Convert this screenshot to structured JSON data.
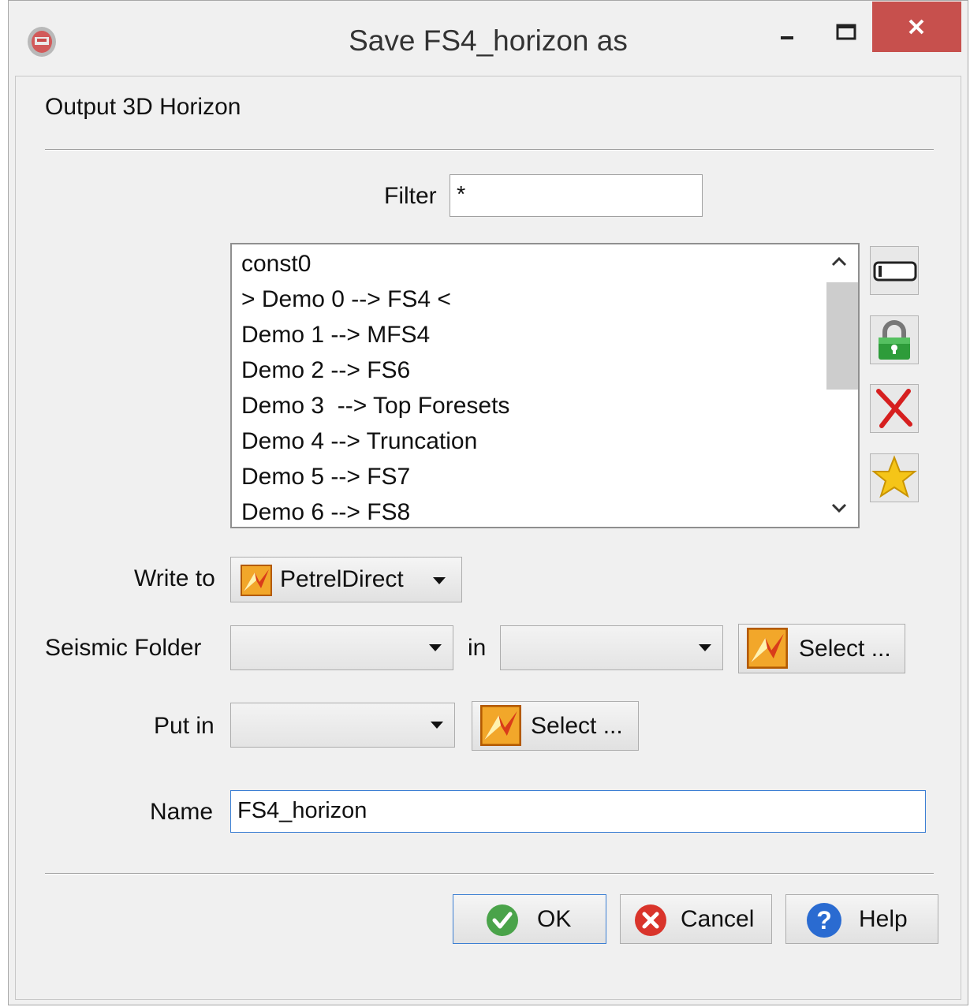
{
  "window": {
    "title": "Save FS4_horizon as"
  },
  "controls": {
    "minimize": "–",
    "maximize": "☐",
    "close": "✕"
  },
  "section": {
    "title": "Output 3D Horizon"
  },
  "filter": {
    "label": "Filter",
    "value": "*"
  },
  "list": {
    "items": [
      "const0",
      "> Demo 0 --> FS4 <",
      "Demo 1 --> MFS4",
      "Demo 2 --> FS6",
      "Demo 3  --> Top Foresets",
      "Demo 4 --> Truncation",
      "Demo 5 --> FS7",
      "Demo 6 --> FS8"
    ],
    "scroll_up": "^",
    "scroll_down": "v"
  },
  "side_buttons": {
    "icons": [
      "rename-icon",
      "lock-icon",
      "delete-icon",
      "favorite-icon"
    ]
  },
  "write_to": {
    "label": "Write to",
    "value": "PetrelDirect"
  },
  "seismic_folder": {
    "label": "Seismic Folder",
    "value": "",
    "in_label": "in",
    "in_value": "",
    "select_label": "Select ..."
  },
  "put_in": {
    "label": "Put in",
    "value": "",
    "select_label": "Select ..."
  },
  "name": {
    "label": "Name",
    "value": "FS4_horizon"
  },
  "buttons": {
    "ok": "OK",
    "cancel": "Cancel",
    "help": "Help"
  },
  "colors": {
    "close": "#c7504d",
    "accent_border": "#3c7fd3",
    "ok_green": "#4aa34a",
    "cancel_red": "#d9342b",
    "help_blue": "#2a6bd1"
  }
}
